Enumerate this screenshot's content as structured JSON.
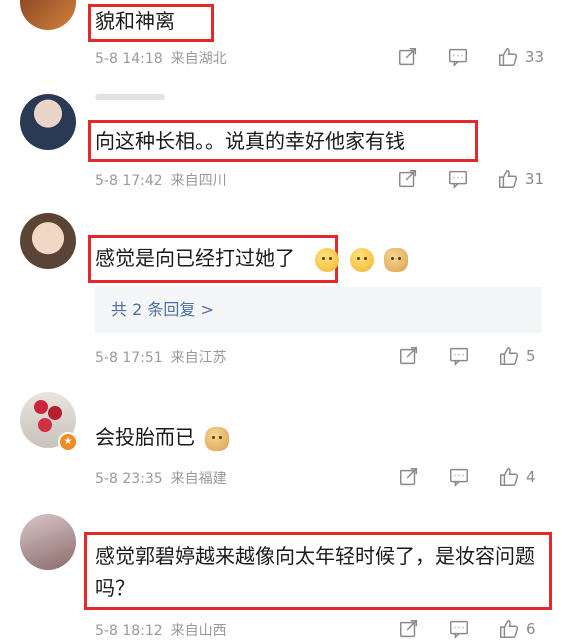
{
  "comments": [
    {
      "text": "貌和神离",
      "date": "5-8 14:18",
      "source": "来自湖北",
      "likes": "33",
      "highlighted": true
    },
    {
      "text": "向这种长相。。说真的幸好他家有钱",
      "date": "5-8 17:42",
      "source": "来自四川",
      "likes": "31",
      "highlighted": true
    },
    {
      "text": "感觉是向已经打过她了",
      "date": "5-8 17:51",
      "source": "来自江苏",
      "likes": "5",
      "highlighted": true,
      "emojis": [
        "pensive-emoji",
        "shush-emoji",
        "doge-emoji"
      ],
      "replies_label": "共 2 条回复 >"
    },
    {
      "text": "会投胎而已",
      "date": "5-8 23:35",
      "source": "来自福建",
      "likes": "4",
      "highlighted": false,
      "emojis": [
        "doge-emoji"
      ]
    },
    {
      "text": "感觉郭碧婷越来越像向太年轻时候了，是妆容问题吗？",
      "date": "5-8 18:12",
      "source": "来自山西",
      "likes": "6",
      "highlighted": true
    }
  ],
  "colors": {
    "highlight": "#e5282a",
    "meta": "#9a9a9a",
    "reply_link": "#4a6fa5"
  }
}
